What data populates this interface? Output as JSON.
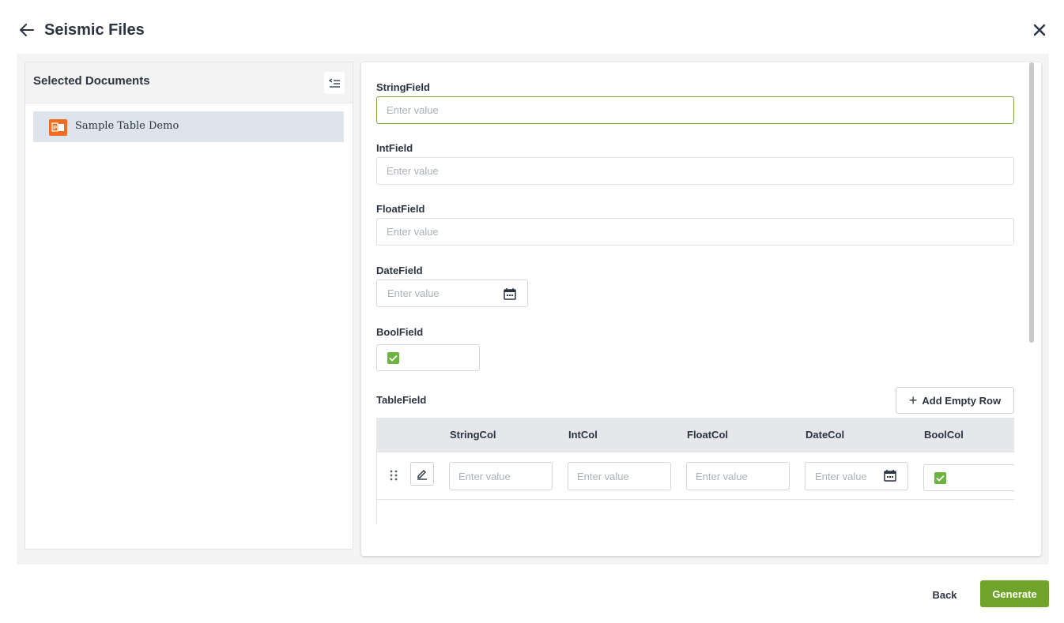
{
  "header": {
    "title": "Seismic Files",
    "back_icon": "arrow-left-icon",
    "close_icon": "close-icon"
  },
  "sidebar": {
    "title": "Selected Documents",
    "collapse_icon": "collapse-list-icon",
    "documents": [
      {
        "label": "Sample Table Demo",
        "icon": "powerpoint-file-icon"
      }
    ]
  },
  "form": {
    "string_field": {
      "label": "StringField",
      "placeholder": "Enter value"
    },
    "int_field": {
      "label": "IntField",
      "placeholder": "Enter value"
    },
    "float_field": {
      "label": "FloatField",
      "placeholder": "Enter value"
    },
    "date_field": {
      "label": "DateField",
      "placeholder": "Enter value"
    },
    "bool_field": {
      "label": "BoolField",
      "checked": true
    },
    "table_field": {
      "label": "TableField",
      "add_row_label": "Add Empty Row",
      "columns": [
        "StringCol",
        "IntCol",
        "FloatCol",
        "DateCol",
        "BoolCol"
      ],
      "rows": [
        {
          "string_placeholder": "Enter value",
          "int_placeholder": "Enter value",
          "float_placeholder": "Enter value",
          "date_placeholder": "Enter value",
          "bool_checked": true
        }
      ]
    }
  },
  "footer": {
    "back_label": "Back",
    "generate_label": "Generate"
  },
  "colors": {
    "accent": "#6fa329",
    "checkbox": "#6cb33f",
    "doc_icon": "#f26c1d",
    "selected_item": "#dde4ec",
    "focus_border": "#7fa64a"
  }
}
